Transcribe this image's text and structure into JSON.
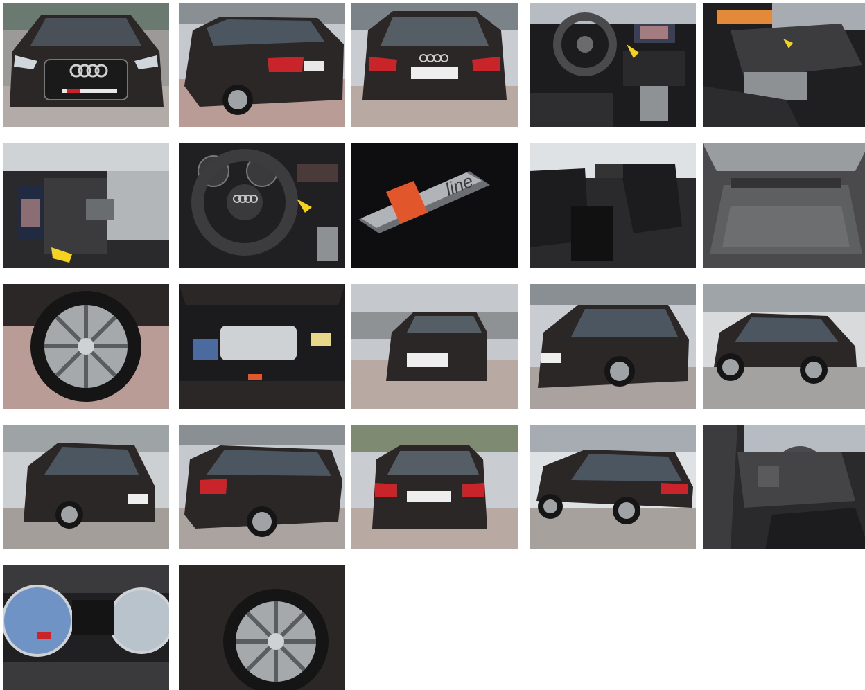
{
  "gallery": {
    "photos": [
      {
        "subject": "front"
      },
      {
        "subject": "rear-quarter"
      },
      {
        "subject": "rear"
      },
      {
        "subject": "dashboard"
      },
      {
        "subject": "interior-side"
      },
      {
        "subject": "center-console"
      },
      {
        "subject": "steering-wheel"
      },
      {
        "subject": "s-line-badge",
        "badge_text": "line"
      },
      {
        "subject": "front-seats"
      },
      {
        "subject": "cargo-area"
      },
      {
        "subject": "wheel"
      },
      {
        "subject": "engine-bay"
      },
      {
        "subject": "front-yard"
      },
      {
        "subject": "front-quarter-sunny"
      },
      {
        "subject": "side-profile"
      },
      {
        "subject": "front-quarter-yard"
      },
      {
        "subject": "rear-quarter-yard"
      },
      {
        "subject": "rear-yard"
      },
      {
        "subject": "side-yard"
      },
      {
        "subject": "interior-door-open"
      },
      {
        "subject": "instrument-cluster"
      },
      {
        "subject": "wheel-closeup"
      }
    ]
  },
  "colors": {
    "car_body": "#2b2726",
    "taillight": "#c8242a",
    "pavement": "#b9a9a3",
    "interior": "#1c1c1e",
    "badge_orange": "#e2562c",
    "tag_yellow": "#f4d21f",
    "sky": "#d9dde2"
  }
}
